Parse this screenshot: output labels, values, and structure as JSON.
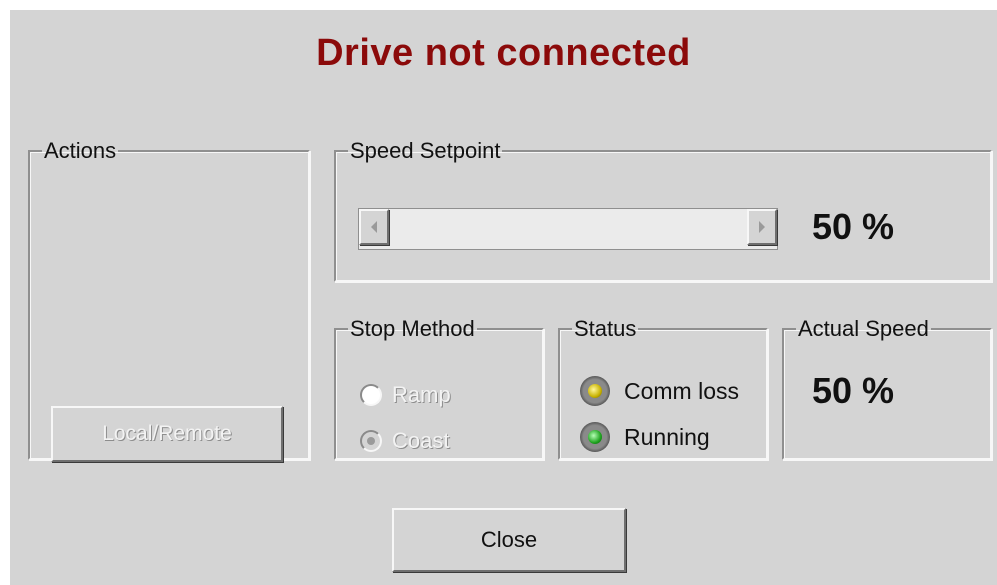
{
  "title": "Drive not connected",
  "colors": {
    "title": "#8b0a0a",
    "background": "#d4d4d4",
    "comm_loss_lamp": "#c8b200",
    "running_lamp": "#1fa31f"
  },
  "actions": {
    "legend": "Actions",
    "local_remote_button": "Local/Remote",
    "local_remote_enabled": false
  },
  "speed_setpoint": {
    "legend": "Speed Setpoint",
    "value_text": "50 %",
    "slider_value": 0,
    "left_arrow_icon": "triangle-left-icon",
    "right_arrow_icon": "triangle-right-icon"
  },
  "stop_method": {
    "legend": "Stop Method",
    "options": [
      "Ramp",
      "Coast"
    ],
    "selected": "Coast",
    "enabled": false
  },
  "status": {
    "legend": "Status",
    "items": [
      {
        "label": "Comm loss",
        "lamp": "yellow"
      },
      {
        "label": "Running",
        "lamp": "green"
      }
    ]
  },
  "actual_speed": {
    "legend": "Actual Speed",
    "value_text": "50 %"
  },
  "close_button": "Close"
}
